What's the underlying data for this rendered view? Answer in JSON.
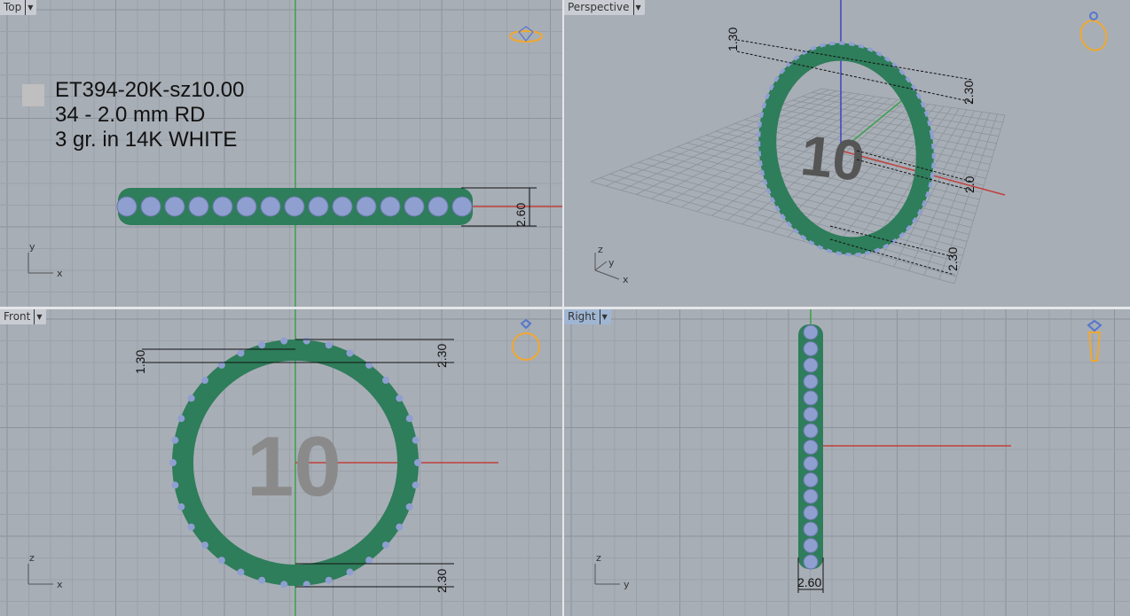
{
  "viewports": {
    "top": {
      "label": "Top",
      "active": false
    },
    "perspective": {
      "label": "Perspective",
      "active": false
    },
    "front": {
      "label": "Front",
      "active": false
    },
    "right": {
      "label": "Right",
      "active": true
    }
  },
  "annotation": {
    "line1": "ET394-20K-sz10.00",
    "line2": "34 - 2.0 mm RD",
    "line3": "3 gr.  in 14K WHITE"
  },
  "ring_size_label": "10",
  "dimensions": {
    "width": "2.60",
    "top_height": "2.30",
    "bottom_height": "2.30",
    "stone_offset": "1.30",
    "persp_small": "2.0"
  },
  "axes": {
    "x": "x",
    "y": "y",
    "z": "z"
  },
  "colors": {
    "band": "#2e7d5b",
    "stone": "#8f9fd0",
    "x_axis": "#c0403a",
    "y_axis": "#3aa04a",
    "z_axis": "#4040c0",
    "widget": "#f0a830"
  }
}
